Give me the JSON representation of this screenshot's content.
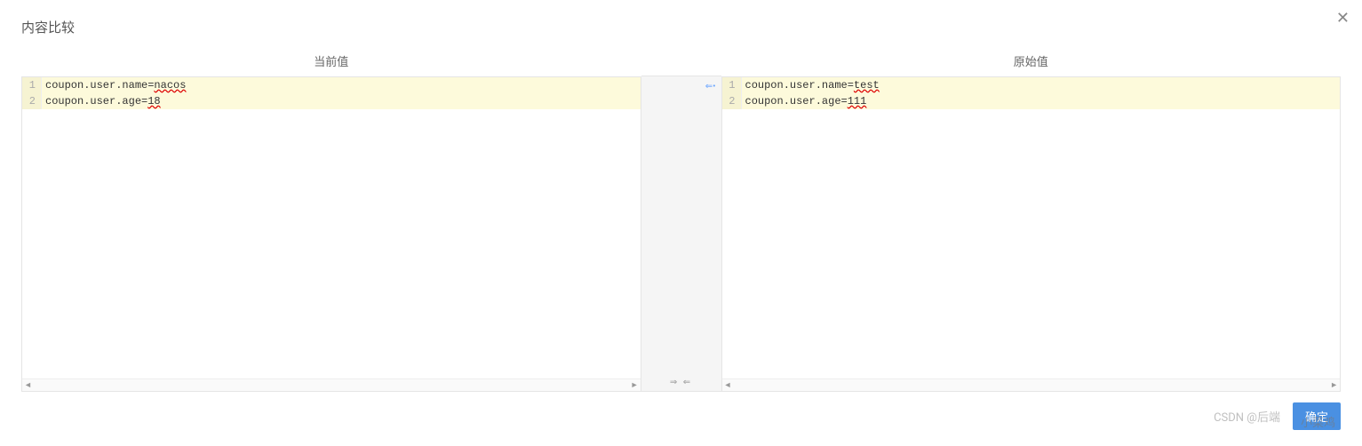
{
  "modal": {
    "title": "内容比较",
    "close_icon": "✕"
  },
  "panes": {
    "left": {
      "title": "当前值",
      "lines": [
        {
          "num": "1",
          "prefix": "coupon.user.name=",
          "diff": "nacos"
        },
        {
          "num": "2",
          "prefix": "coupon.user.age=",
          "diff": "18"
        }
      ]
    },
    "right": {
      "title": "原始值",
      "lines": [
        {
          "num": "1",
          "prefix": "coupon.user.name=",
          "diff": "test"
        },
        {
          "num": "2",
          "prefix": "coupon.user.age=",
          "diff": "111"
        }
      ]
    }
  },
  "middle": {
    "top_marker": "⇐•",
    "bottom_marker": "⇒ ⇐"
  },
  "scroll": {
    "left_arrow": "◄",
    "right_arrow": "►"
  },
  "footer": {
    "watermark_left": "CSDN @后端",
    "button": "确定",
    "watermark_overlap": "小菜鸡"
  }
}
